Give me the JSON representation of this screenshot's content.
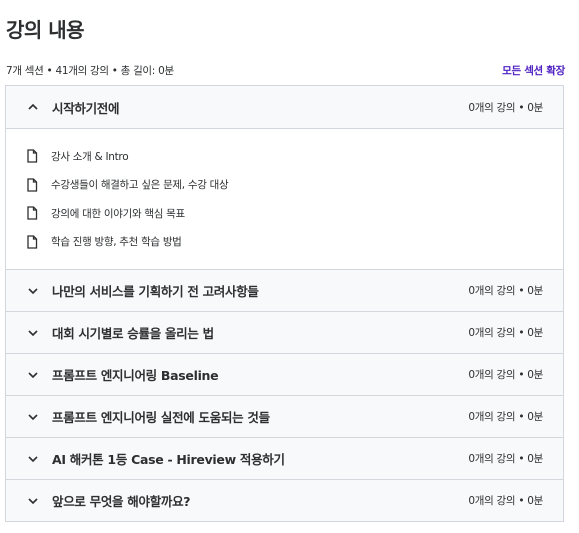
{
  "page": {
    "title": "강의 내용",
    "summary": "7개 섹션 • 41개의 강의 • 총 길이: 0분",
    "expand_all_label": "모든 섹션 확장"
  },
  "sections": [
    {
      "title": "시작하기전에",
      "meta": "0개의 강의 • 0분",
      "expanded": true,
      "lectures": [
        {
          "title": "강사 소개 & Intro",
          "icon": "document-icon"
        },
        {
          "title": "수강생들이 해결하고 싶은 문제, 수강 대상",
          "icon": "document-icon"
        },
        {
          "title": "강의에 대한 이야기와 핵심 목표",
          "icon": "document-icon"
        },
        {
          "title": "학습 진행 방향, 추천 학습 방법",
          "icon": "document-icon"
        }
      ]
    },
    {
      "title": "나만의 서비스를 기획하기 전 고려사항들",
      "meta": "0개의 강의 • 0분",
      "expanded": false
    },
    {
      "title": "대회 시기별로 승률을 올리는 법",
      "meta": "0개의 강의 • 0분",
      "expanded": false
    },
    {
      "title": "프롬프트 엔지니어링 Baseline",
      "meta": "0개의 강의 • 0분",
      "expanded": false
    },
    {
      "title": "프롬프트 엔지니어링 실전에 도움되는 것들",
      "meta": "0개의 강의 • 0분",
      "expanded": false
    },
    {
      "title": "AI 해커톤 1등 Case - Hireview 적용하기",
      "meta": "0개의 강의 • 0분",
      "expanded": false
    },
    {
      "title": "앞으로 무엇을 해야할까요?",
      "meta": "0개의 강의 • 0분",
      "expanded": false
    }
  ],
  "colors": {
    "text": "#2d2f31",
    "link": "#5022c3",
    "border": "#d1d7dc",
    "section_bg": "#f7f9fa"
  }
}
